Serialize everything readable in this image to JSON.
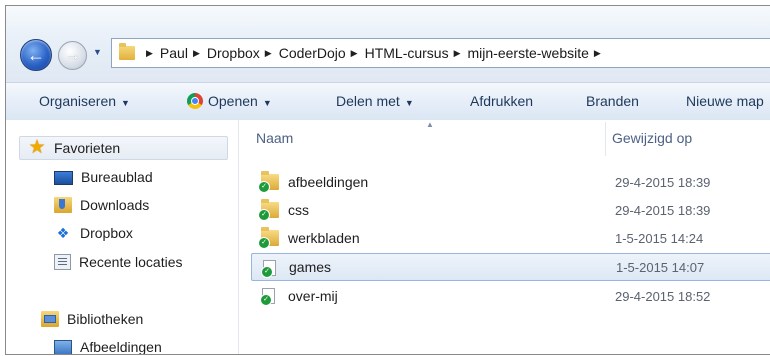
{
  "address_bar": {
    "crumbs": [
      "Paul",
      "Dropbox",
      "CoderDojo",
      "HTML-cursus",
      "mijn-eerste-website"
    ]
  },
  "toolbar": {
    "organize_label": "Organiseren",
    "open_label": "Openen",
    "share_label": "Delen met",
    "print_label": "Afdrukken",
    "burn_label": "Branden",
    "new_folder_label": "Nieuwe map"
  },
  "navpane": {
    "favorites_label": "Favorieten",
    "items": [
      {
        "label": "Bureaublad",
        "icon": "desktop-icon"
      },
      {
        "label": "Downloads",
        "icon": "downloads-icon"
      },
      {
        "label": "Dropbox",
        "icon": "dropbox-icon"
      },
      {
        "label": "Recente locaties",
        "icon": "recent-places-icon"
      }
    ],
    "libraries_label": "Bibliotheken",
    "library_items": [
      {
        "label": "Afbeeldingen",
        "icon": "pictures-icon"
      }
    ]
  },
  "filelist": {
    "columns": {
      "name": "Naam",
      "modified": "Gewijzigd op"
    },
    "rows": [
      {
        "name": "afbeeldingen",
        "date": "29-4-2015 18:39",
        "type": "folder"
      },
      {
        "name": "css",
        "date": "29-4-2015 18:39",
        "type": "folder"
      },
      {
        "name": "werkbladen",
        "date": "1-5-2015 14:24",
        "type": "folder"
      },
      {
        "name": "games",
        "date": "1-5-2015 14:07",
        "type": "file",
        "selected": true
      },
      {
        "name": "over-mij",
        "date": "29-4-2015 18:52",
        "type": "file"
      }
    ]
  },
  "colors": {
    "accent": "#2a62c6",
    "selection_border": "#98b5dd",
    "sync_badge": "#1f9a3b"
  }
}
